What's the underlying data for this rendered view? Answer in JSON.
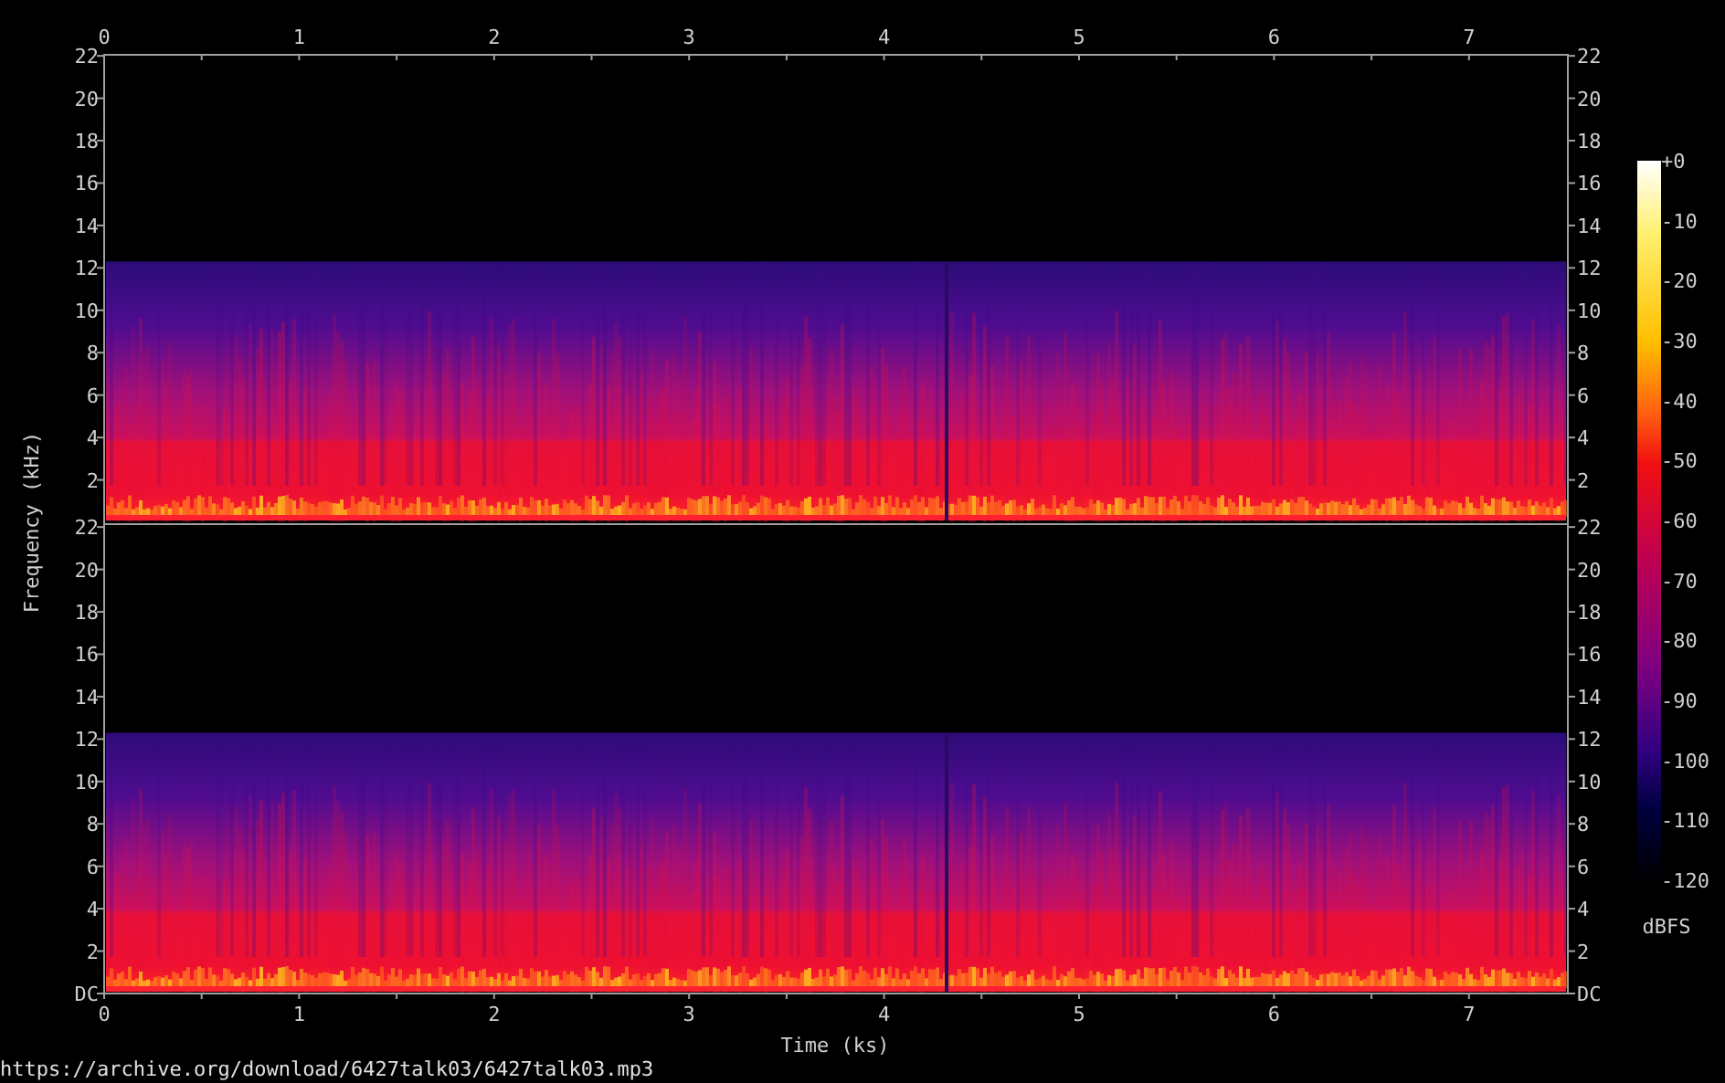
{
  "time_axis": {
    "label": "Time (ks)",
    "top_ticks": [
      "0",
      "1",
      "2",
      "3",
      "4",
      "5",
      "6",
      "7"
    ],
    "bottom_ticks": [
      "0",
      "1",
      "2",
      "3",
      "4",
      "5",
      "6",
      "7"
    ]
  },
  "frequency_axis": {
    "label": "Frequency (kHz)"
  },
  "channels": [
    {
      "left_ticks": [
        "22",
        "20",
        "18",
        "16",
        "14",
        "12",
        "10",
        "8",
        "6",
        "4",
        "2"
      ],
      "right_ticks": [
        "22",
        "20",
        "18",
        "16",
        "14",
        "12",
        "10",
        "8",
        "6",
        "4",
        "2"
      ]
    },
    {
      "left_ticks": [
        "22",
        "20",
        "18",
        "16",
        "14",
        "12",
        "10",
        "8",
        "6",
        "4",
        "2",
        "DC"
      ],
      "right_ticks": [
        "22",
        "20",
        "18",
        "16",
        "14",
        "12",
        "10",
        "8",
        "6",
        "4",
        "2",
        "DC"
      ]
    }
  ],
  "colorbar": {
    "labels": [
      "+0",
      "-10",
      "-20",
      "-30",
      "-40",
      "-50",
      "-60",
      "-70",
      "-80",
      "-90",
      "-100",
      "-110",
      "-120"
    ],
    "unit": "dBFS"
  },
  "source_url": "https://archive.org/download/6427talk03/6427talk03.mp3"
}
